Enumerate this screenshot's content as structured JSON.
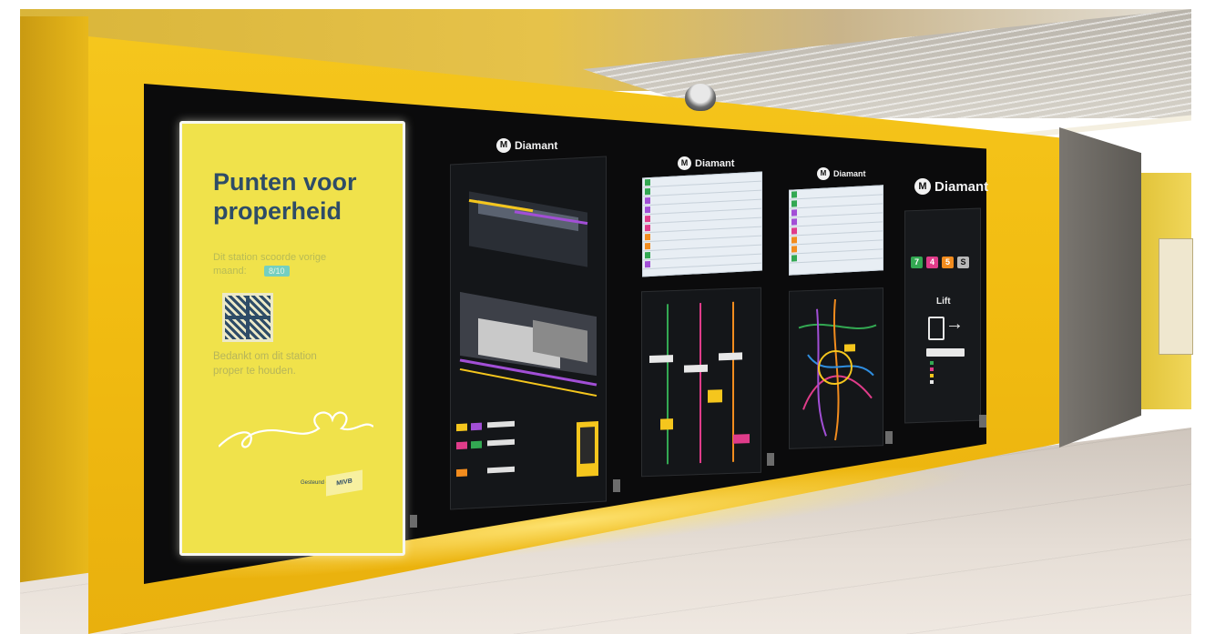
{
  "poster": {
    "title": "Punten voor properheid",
    "score_text": "Dit station scoorde vorige maand:",
    "score_value": "8/10",
    "thanks": "Bedankt om dit station proper te houden.",
    "sponsor": "Gesteund door",
    "logo": "MIVB"
  },
  "screens": {
    "brand": "Diamant",
    "brand_letter": "M",
    "lift_label": "Lift",
    "line_badges": [
      {
        "label": "7",
        "color": "#33a852"
      },
      {
        "label": "4",
        "color": "#e03c8a"
      },
      {
        "label": "5",
        "color": "#f28c1e"
      },
      {
        "label": "S",
        "color": "#b8b8b8"
      }
    ]
  },
  "colors": {
    "wall_yellow": "#f2bd12",
    "poster_yellow": "#f0e24b",
    "poster_navy": "#2e4c67",
    "display_black": "#0b0b0c"
  }
}
